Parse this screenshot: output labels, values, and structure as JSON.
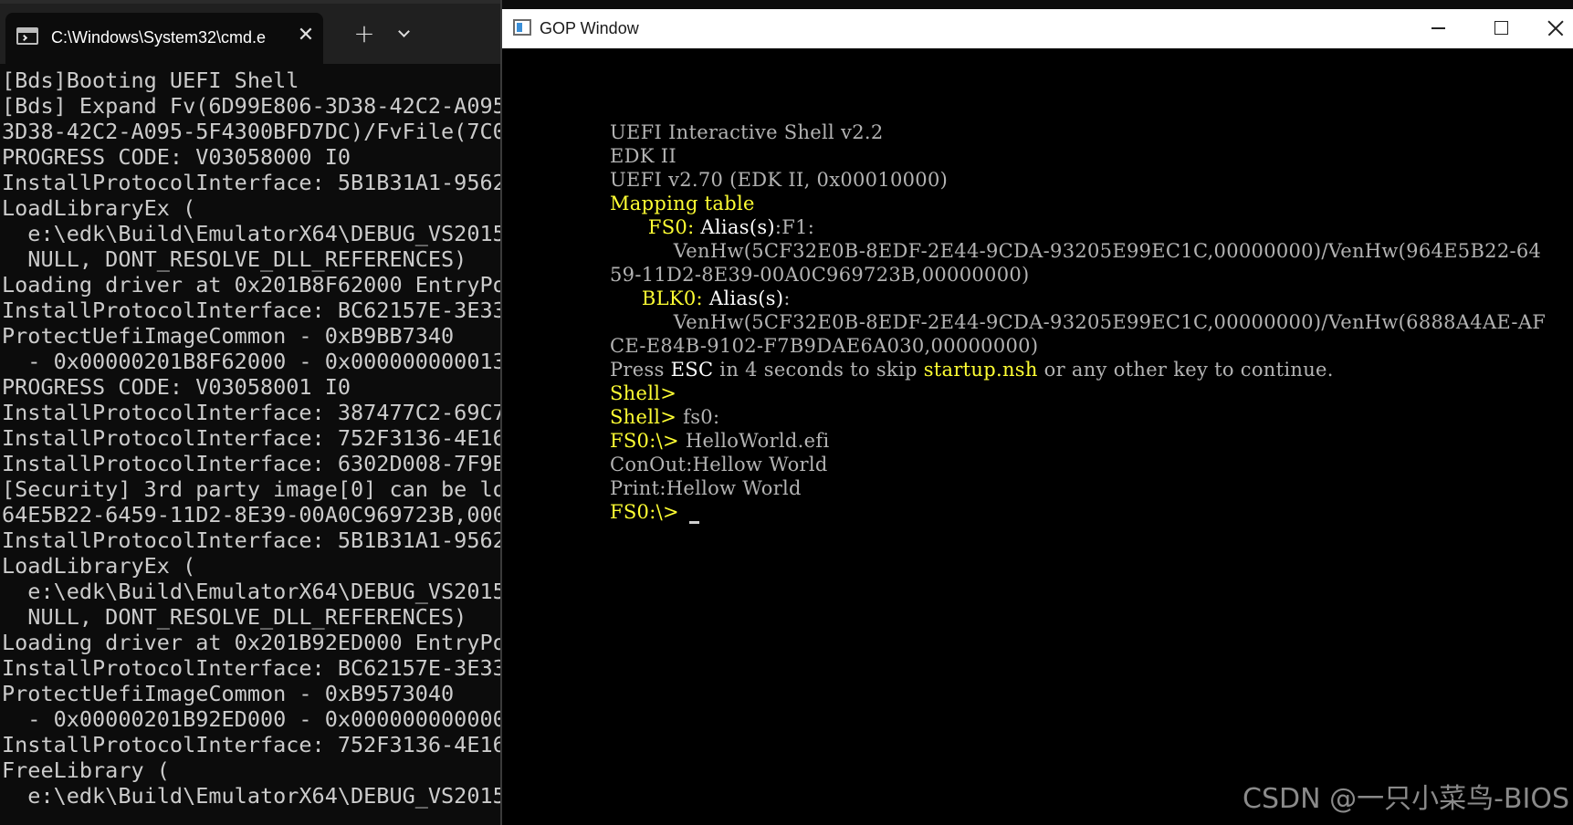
{
  "terminal": {
    "tab_title": "C:\\Windows\\System32\\cmd.e",
    "tab_close": "✕",
    "new_tab": "+",
    "lines": [
      "[Bds]Booting UEFI Shell",
      "[Bds] Expand Fv(6D99E806-3D38-42C2-A095",
      "3D38-42C2-A095-5F4300BFD7DC)/FvFile(7C0",
      "PROGRESS CODE: V03058000 I0",
      "InstallProtocolInterface: 5B1B31A1-9562",
      "LoadLibraryEx (",
      "  e:\\edk\\Build\\EmulatorX64\\DEBUG_VS2015",
      "  NULL, DONT_RESOLVE_DLL_REFERENCES)",
      "Loading driver at 0x201B8F62000 EntryPo",
      "InstallProtocolInterface: BC62157E-3E33",
      "ProtectUefiImageCommon - 0xB9BB7340",
      "  - 0x00000201B8F62000 - 0x000000000013",
      "PROGRESS CODE: V03058001 I0",
      "InstallProtocolInterface: 387477C2-69C7",
      "InstallProtocolInterface: 752F3136-4E16",
      "InstallProtocolInterface: 6302D008-7F9B",
      "[Security] 3rd party image[0] can be lo",
      "64E5B22-6459-11D2-8E39-00A0C969723B,000",
      "InstallProtocolInterface: 5B1B31A1-9562",
      "LoadLibraryEx (",
      "  e:\\edk\\Build\\EmulatorX64\\DEBUG_VS2015",
      "  NULL, DONT_RESOLVE_DLL_REFERENCES)",
      "Loading driver at 0x201B92ED000 EntryPo",
      "InstallProtocolInterface: BC62157E-3E33",
      "ProtectUefiImageCommon - 0xB9573040",
      "  - 0x00000201B92ED000 - 0x000000000000",
      "InstallProtocolInterface: 752F3136-4E16",
      "FreeLibrary (",
      "  e:\\edk\\Build\\EmulatorX64\\DEBUG_VS2015"
    ]
  },
  "gop": {
    "title": "GOP Window",
    "shell_lines": [
      [
        {
          "t": "UEFI Interactive Shell v2.2",
          "c": "g"
        }
      ],
      [
        {
          "t": "EDK II",
          "c": "g"
        }
      ],
      [
        {
          "t": "UEFI v2.70 (EDK II, 0x00010000)",
          "c": "g"
        }
      ],
      [
        {
          "t": "Mapping table",
          "c": "y"
        }
      ],
      [
        {
          "t": "      ",
          "c": "g"
        },
        {
          "t": "FS0:",
          "c": "y"
        },
        {
          "t": " Alias(s)",
          "c": "w"
        },
        {
          "t": ":F1:",
          "c": "g"
        }
      ],
      [
        {
          "t": "          VenHw(5CF32E0B-8EDF-2E44-9CDA-93205E99EC1C,00000000)/VenHw(964E5B22-64",
          "c": "g"
        }
      ],
      [
        {
          "t": "59-11D2-8E39-00A0C969723B,00000000)",
          "c": "g"
        }
      ],
      [
        {
          "t": "     ",
          "c": "g"
        },
        {
          "t": "BLK0:",
          "c": "y"
        },
        {
          "t": " Alias(s)",
          "c": "w"
        },
        {
          "t": ":",
          "c": "g"
        }
      ],
      [
        {
          "t": "          VenHw(5CF32E0B-8EDF-2E44-9CDA-93205E99EC1C,00000000)/VenHw(6888A4AE-AF",
          "c": "g"
        }
      ],
      [
        {
          "t": "CE-E84B-9102-F7B9DAE6A030,00000000)",
          "c": "g"
        }
      ],
      [
        {
          "t": "Press ",
          "c": "g"
        },
        {
          "t": "ESC",
          "c": "w"
        },
        {
          "t": " in 4 seconds to skip ",
          "c": "g"
        },
        {
          "t": "startup.nsh",
          "c": "y"
        },
        {
          "t": " or any other key to continue.",
          "c": "g"
        }
      ],
      [
        {
          "t": "Shell>",
          "c": "y"
        }
      ],
      [
        {
          "t": "Shell>",
          "c": "y"
        },
        {
          "t": " fs0:",
          "c": "g"
        }
      ],
      [
        {
          "t": "FS0:\\>",
          "c": "y"
        },
        {
          "t": " HelloWorld.efi",
          "c": "g"
        }
      ],
      [
        {
          "t": "ConOut:Hellow World",
          "c": "g"
        }
      ],
      [
        {
          "t": "Print:Hellow World",
          "c": "g"
        }
      ],
      [
        {
          "t": "FS0:\\>",
          "c": "y"
        },
        {
          "t": " ",
          "c": "g"
        }
      ]
    ]
  },
  "watermark": "CSDN @一只小菜鸟-BIOS"
}
